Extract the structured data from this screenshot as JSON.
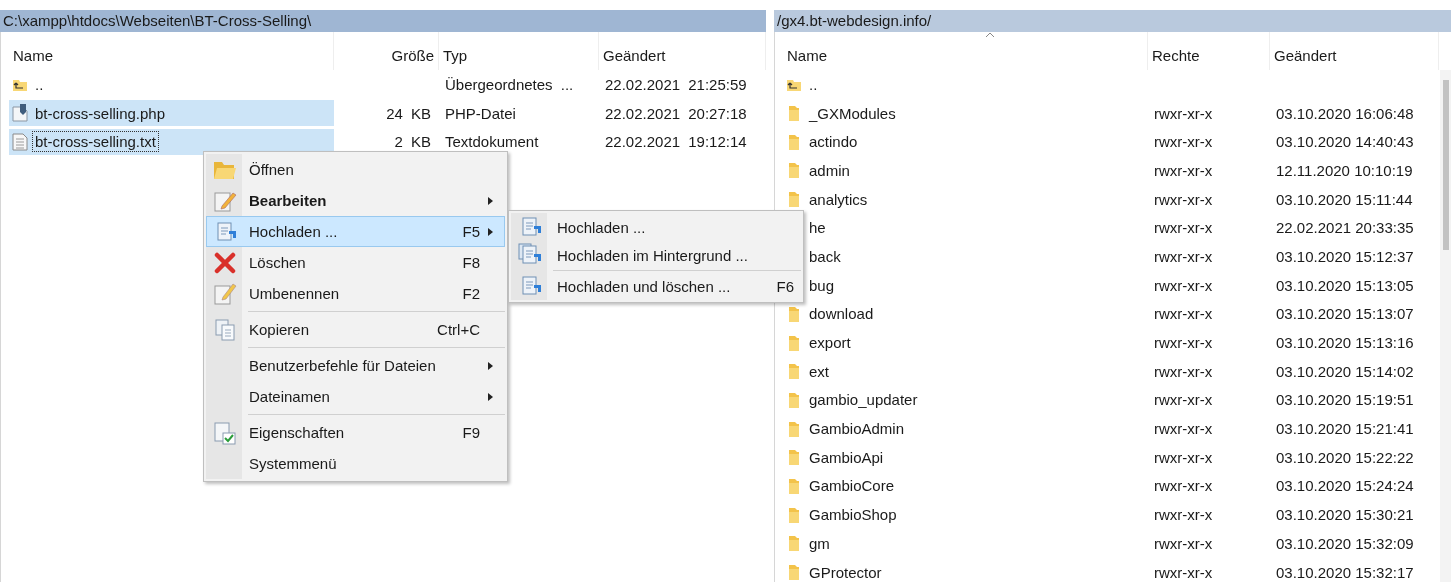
{
  "panes": [
    {
      "path": "C:\\xampp\\htdocs\\Webseiten\\BT-Cross-Selling\\",
      "active": true,
      "kind": "local",
      "columns": [
        {
          "label": "Name",
          "sorted": false
        },
        {
          "label": "Größe",
          "sorted": false
        },
        {
          "label": "Typ",
          "sorted": false
        },
        {
          "label": "Geändert",
          "sorted": false
        }
      ],
      "rows": [
        {
          "kind": "parent",
          "selected": false,
          "focused": false,
          "cells": [
            "..",
            "",
            "Übergeordnetes ...",
            "22.02.2021  21:25:59"
          ]
        },
        {
          "kind": "php",
          "selected": true,
          "focused": false,
          "cells": [
            "bt-cross-selling.php",
            "24 KB",
            "PHP-Datei",
            "22.02.2021  20:27:18"
          ]
        },
        {
          "kind": "text",
          "selected": true,
          "focused": true,
          "cells": [
            "bt-cross-selling.txt",
            "2 KB",
            "Textdokument",
            "22.02.2021  19:12:14"
          ]
        }
      ]
    },
    {
      "path": "/gx4.bt-webdesign.info/",
      "active": false,
      "kind": "remote",
      "columns": [
        {
          "label": "Name",
          "sorted": true
        },
        {
          "label": "Rechte",
          "sorted": false
        },
        {
          "label": "Geändert",
          "sorted": false
        }
      ],
      "rows": [
        {
          "kind": "parent",
          "selected": false,
          "focused": false,
          "cells": [
            "..",
            "",
            ""
          ]
        },
        {
          "kind": "folder",
          "selected": false,
          "focused": false,
          "cells": [
            "_GXModules",
            "rwxr-xr-x",
            "03.10.2020 16:06:48"
          ]
        },
        {
          "kind": "folder",
          "selected": false,
          "focused": false,
          "cells": [
            "actindo",
            "rwxr-xr-x",
            "03.10.2020 14:40:43"
          ]
        },
        {
          "kind": "folder",
          "selected": false,
          "focused": false,
          "cells": [
            "admin",
            "rwxr-xr-x",
            "12.11.2020 10:10:19"
          ]
        },
        {
          "kind": "folder",
          "selected": false,
          "focused": false,
          "cells": [
            "analytics",
            "rwxr-xr-x",
            "03.10.2020 15:11:44"
          ]
        },
        {
          "selected": false,
          "focused": false,
          "cells": [
            "he",
            "rwxr-xr-x",
            "22.02.2021 20:33:35"
          ]
        },
        {
          "selected": false,
          "focused": false,
          "cells": [
            "back",
            "rwxr-xr-x",
            "03.10.2020 15:12:37"
          ]
        },
        {
          "selected": false,
          "focused": false,
          "cells": [
            "bug",
            "rwxr-xr-x",
            "03.10.2020 15:13:05"
          ]
        },
        {
          "kind": "folder",
          "selected": false,
          "focused": false,
          "cells": [
            "download",
            "rwxr-xr-x",
            "03.10.2020 15:13:07"
          ]
        },
        {
          "kind": "folder",
          "selected": false,
          "focused": false,
          "cells": [
            "export",
            "rwxr-xr-x",
            "03.10.2020 15:13:16"
          ]
        },
        {
          "kind": "folder",
          "selected": false,
          "focused": false,
          "cells": [
            "ext",
            "rwxr-xr-x",
            "03.10.2020 15:14:02"
          ]
        },
        {
          "kind": "folder",
          "selected": false,
          "focused": false,
          "cells": [
            "gambio_updater",
            "rwxr-xr-x",
            "03.10.2020 15:19:51"
          ]
        },
        {
          "kind": "folder",
          "selected": false,
          "focused": false,
          "cells": [
            "GambioAdmin",
            "rwxr-xr-x",
            "03.10.2020 15:21:41"
          ]
        },
        {
          "kind": "folder",
          "selected": false,
          "focused": false,
          "cells": [
            "GambioApi",
            "rwxr-xr-x",
            "03.10.2020 15:22:22"
          ]
        },
        {
          "kind": "folder",
          "selected": false,
          "focused": false,
          "cells": [
            "GambioCore",
            "rwxr-xr-x",
            "03.10.2020 15:24:24"
          ]
        },
        {
          "kind": "folder",
          "selected": false,
          "focused": false,
          "cells": [
            "GambioShop",
            "rwxr-xr-x",
            "03.10.2020 15:30:21"
          ]
        },
        {
          "kind": "folder",
          "selected": false,
          "focused": false,
          "cells": [
            "gm",
            "rwxr-xr-x",
            "03.10.2020 15:32:09"
          ]
        },
        {
          "kind": "folder",
          "selected": false,
          "focused": false,
          "cells": [
            "GProtector",
            "rwxr-xr-x",
            "03.10.2020 15:32:17"
          ]
        }
      ]
    }
  ],
  "context_menu": {
    "items": [
      {
        "kind": "open",
        "label": "Öffnen",
        "bold": false,
        "submenu": false,
        "selected": false
      },
      {
        "kind": "edit",
        "label": "Bearbeiten",
        "bold": true,
        "submenu": true,
        "selected": false
      },
      {
        "kind": "upload",
        "label": "Hochladen ...",
        "shortcut": "F5",
        "bold": false,
        "submenu": true,
        "selected": true
      },
      {
        "kind": "delete",
        "label": "Löschen",
        "shortcut": "F8",
        "bold": false,
        "submenu": false,
        "selected": false
      },
      {
        "kind": "rename",
        "label": "Umbenennen",
        "shortcut": "F2",
        "bold": false,
        "submenu": false,
        "selected": false
      },
      {
        "kind": "separator"
      },
      {
        "kind": "copy",
        "label": "Kopieren",
        "shortcut": "Ctrl+C",
        "bold": false,
        "submenu": false,
        "selected": false
      },
      {
        "kind": "separator"
      },
      {
        "kind": "plain",
        "label": "Benutzerbefehle für Dateien",
        "bold": false,
        "submenu": true,
        "selected": false
      },
      {
        "kind": "plain",
        "label": "Dateinamen",
        "bold": false,
        "submenu": true,
        "selected": false
      },
      {
        "kind": "separator"
      },
      {
        "kind": "properties",
        "label": "Eigenschaften",
        "shortcut": "F9",
        "bold": false,
        "submenu": false,
        "selected": false
      },
      {
        "kind": "plain",
        "label": "Systemmenü",
        "bold": false,
        "submenu": false,
        "selected": false
      }
    ]
  },
  "submenu": {
    "items": [
      {
        "kind": "upload",
        "label": "Hochladen ...",
        "bold": false,
        "submenu": false,
        "selected": false
      },
      {
        "kind": "upload-background",
        "label": "Hochladen im Hintergrund ...",
        "bold": false,
        "submenu": false,
        "selected": false
      },
      {
        "kind": "separator"
      },
      {
        "kind": "upload",
        "label": "Hochladen und löschen ...",
        "shortcut": "F6",
        "bold": false,
        "submenu": false,
        "selected": false
      }
    ]
  }
}
